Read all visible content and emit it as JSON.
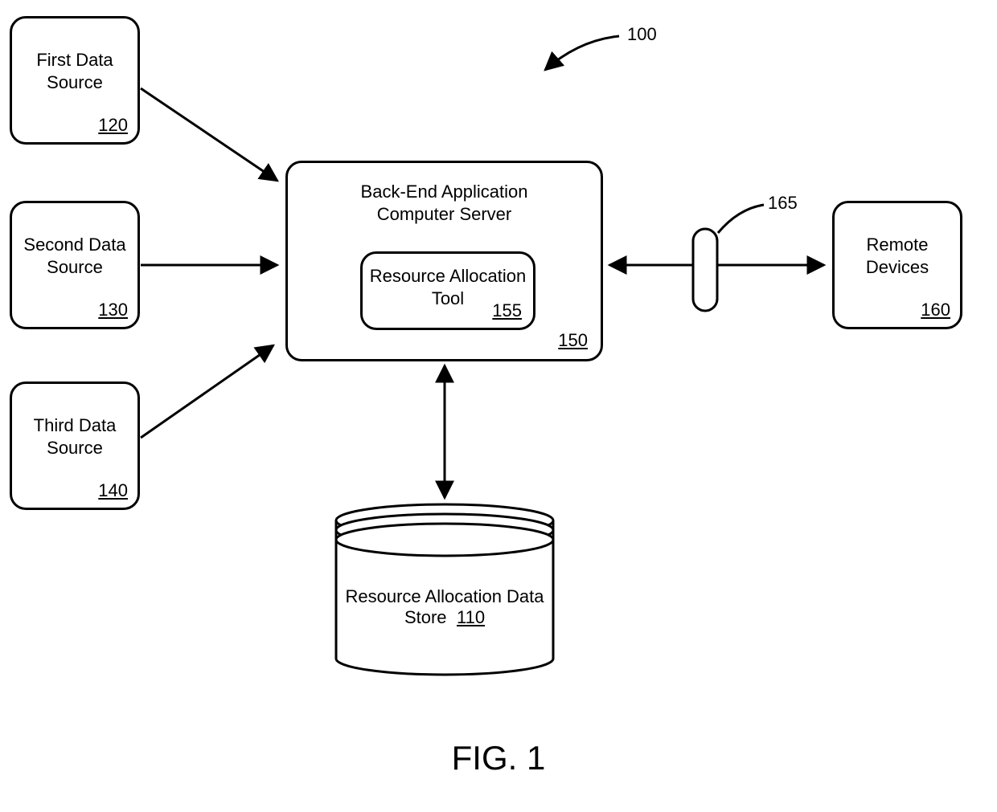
{
  "figure_ref": "100",
  "firewall_ref": "165",
  "figure_caption": "FIG. 1",
  "boxes": {
    "first_data_source": {
      "label": "First Data\nSource",
      "ref": "120"
    },
    "second_data_source": {
      "label": "Second Data\nSource",
      "ref": "130"
    },
    "third_data_source": {
      "label": "Third Data\nSource",
      "ref": "140"
    },
    "server": {
      "label": "Back-End Application\nComputer Server",
      "ref": "150"
    },
    "tool": {
      "label": "Resource Allocation\nTool",
      "ref": "155"
    },
    "datastore": {
      "label": "Resource Allocation Data\nStore",
      "ref": "110"
    },
    "remote": {
      "label": "Remote\nDevices",
      "ref": "160"
    }
  }
}
